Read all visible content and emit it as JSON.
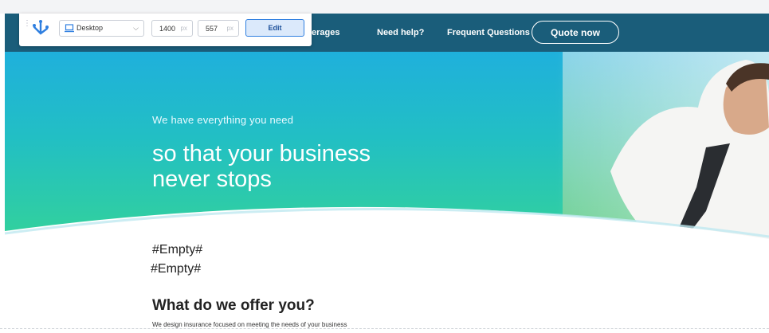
{
  "nav": {
    "coverages_partial": "erages",
    "need_help": "Need help?",
    "faq": "Frequent Questions",
    "quote": "Quote now"
  },
  "hero": {
    "subtitle": "We have everything you need",
    "title_line1": "so that your business",
    "title_line2": "never stops"
  },
  "content": {
    "empty1": "#Empty#",
    "empty2": "#Empty#",
    "heading": "What do we offer you?",
    "subheading": "We design insurance focused on meeting the needs of your business"
  },
  "toolbar": {
    "device": "Desktop",
    "width": "1400",
    "height": "557",
    "unit": "px",
    "edit_label": "Edit"
  },
  "colors": {
    "navbar": "#1a5d7a",
    "hero_top": "#1fb0dc",
    "hero_bottom": "#33d29a",
    "edit_border": "#2f7fe0"
  },
  "icons": [
    "drag-handle-icon",
    "logo-icon",
    "laptop-icon",
    "chevron-down-icon"
  ]
}
